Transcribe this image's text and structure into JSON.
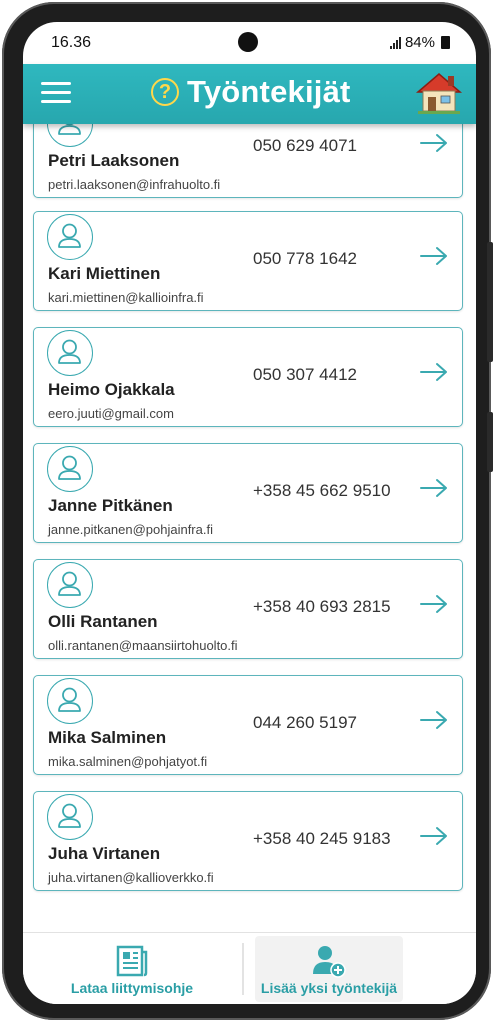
{
  "status": {
    "time": "16.36",
    "battery": "84%"
  },
  "header": {
    "title": "Työntekijät",
    "help_symbol": "?",
    "menu_icon": "hamburger-menu-icon",
    "home_icon": "house-icon"
  },
  "colors": {
    "accent": "#2fb0b7",
    "card_border": "#5db5bc",
    "help": "#ffd84a"
  },
  "employees": [
    {
      "name": "Petri Laaksonen",
      "email": "petri.laaksonen@infrahuolto.fi",
      "phone": "050 629 4071"
    },
    {
      "name": "Kari Miettinen",
      "email": "kari.miettinen@kallioinfra.fi",
      "phone": "050 778 1642"
    },
    {
      "name": "Heimo Ojakkala",
      "email": "eero.juuti@gmail.com",
      "phone": "050 307 4412"
    },
    {
      "name": "Janne Pitkänen",
      "email": "janne.pitkanen@pohjainfra.fi",
      "phone": "+358 45 662 9510"
    },
    {
      "name": "Olli Rantanen",
      "email": "olli.rantanen@maansiirtohuolto.fi",
      "phone": "+358 40 693 2815"
    },
    {
      "name": "Mika Salminen",
      "email": "mika.salminen@pohjatyot.fi",
      "phone": "044 260 5197"
    },
    {
      "name": "Juha Virtanen",
      "email": "juha.virtanen@kallioverkko.fi",
      "phone": "+358 40 245 9183"
    }
  ],
  "bottom_nav": {
    "download": {
      "label": "Lataa liittymisohje",
      "icon": "document-icon"
    },
    "add": {
      "label": "Lisää yksi työntekijä",
      "icon": "add-user-icon"
    }
  }
}
